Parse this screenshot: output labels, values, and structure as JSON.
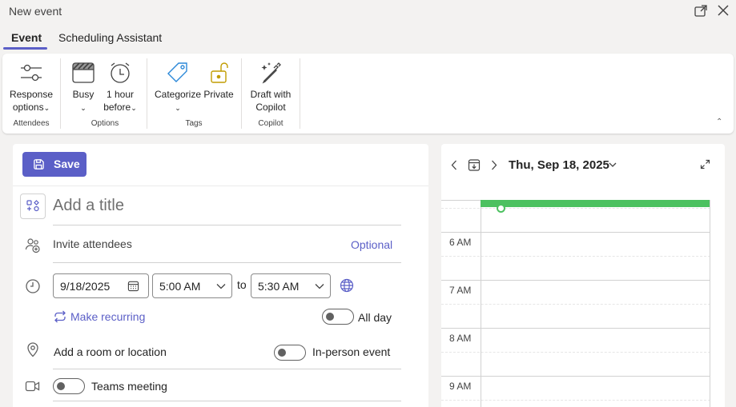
{
  "window": {
    "title": "New event"
  },
  "tabs": [
    {
      "label": "Event"
    },
    {
      "label": "Scheduling Assistant"
    }
  ],
  "ribbon": {
    "groups": {
      "attendees": {
        "label": "Attendees",
        "response_options": {
          "line1": "Response",
          "line2": "options"
        }
      },
      "options": {
        "label": "Options",
        "busy": {
          "label": "Busy"
        },
        "reminder": {
          "line1": "1 hour",
          "line2": "before"
        }
      },
      "tags": {
        "label": "Tags",
        "categorize": {
          "label": "Categorize"
        },
        "private": {
          "label": "Private"
        }
      },
      "copilot": {
        "label": "Copilot",
        "draft": {
          "line1": "Draft with",
          "line2": "Copilot"
        }
      }
    }
  },
  "form": {
    "save_label": "Save",
    "title_placeholder": "Add a title",
    "attendees": {
      "placeholder": "Invite attendees",
      "optional_label": "Optional"
    },
    "date": "9/18/2025",
    "start_time": "5:00 AM",
    "to_label": "to",
    "end_time": "5:30 AM",
    "recurring_label": "Make recurring",
    "all_day_label": "All day",
    "all_day": false,
    "location_placeholder": "Add a room or location",
    "in_person_label": "In-person event",
    "in_person": false,
    "teams_label": "Teams meeting",
    "teams": false
  },
  "calendar": {
    "date_label": "Thu, Sep 18, 2025",
    "hours": [
      "6 AM",
      "7 AM",
      "8 AM",
      "9 AM"
    ]
  },
  "colors": {
    "accent": "#5b5fc7",
    "event_bar": "#4cc160"
  }
}
